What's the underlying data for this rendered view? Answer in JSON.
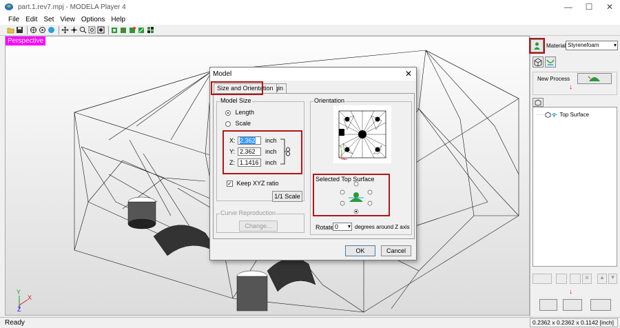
{
  "window": {
    "title": "part.1.rev7.mpj - MODELA Player 4",
    "minimize": "—",
    "maximize": "☐",
    "close": "✕"
  },
  "menu": [
    "File",
    "Edit",
    "Set",
    "View",
    "Options",
    "Help"
  ],
  "viewport": {
    "label": "Perspective",
    "axis_y": "Y",
    "axis_x": "X",
    "axis_z": "Z"
  },
  "right_panel": {
    "material_label": "Material",
    "material_value": "Styrenefoam",
    "new_process_label": "New Process",
    "tree_item": "Top Surface"
  },
  "dialog": {
    "title": "Model",
    "close": "✕",
    "tabs": [
      "Size and Orientation",
      "Origin"
    ],
    "model_size": {
      "caption": "Model Size",
      "option_length": "Length",
      "option_scale": "Scale",
      "x_label": "X:",
      "x_value": "2.362",
      "x_unit": "inch",
      "y_label": "Y:",
      "y_value": "2.362",
      "y_unit": "inch",
      "z_label": "Z:",
      "z_value": "1.1416",
      "z_unit": "inch",
      "keep_ratio": "Keep XYZ ratio",
      "one_to_one": "1/1 Scale"
    },
    "curve": {
      "caption": "Curve Reproduction",
      "change": "Change..."
    },
    "orientation": {
      "caption": "Orientation",
      "selected_top": "Selected Top Surface",
      "rotate_label": "Rotate",
      "rotate_value": "0",
      "rotate_suffix": "degrees around Z axis"
    },
    "ok": "OK",
    "cancel": "Cancel"
  },
  "status": {
    "left": "Ready",
    "right": "0.2362 x 0.2362 x 0.1142 [inch]"
  },
  "colors": {
    "highlight_red": "#b0161a",
    "perspective_bg": "#ff00ff",
    "selection_blue": "#3399ff"
  }
}
